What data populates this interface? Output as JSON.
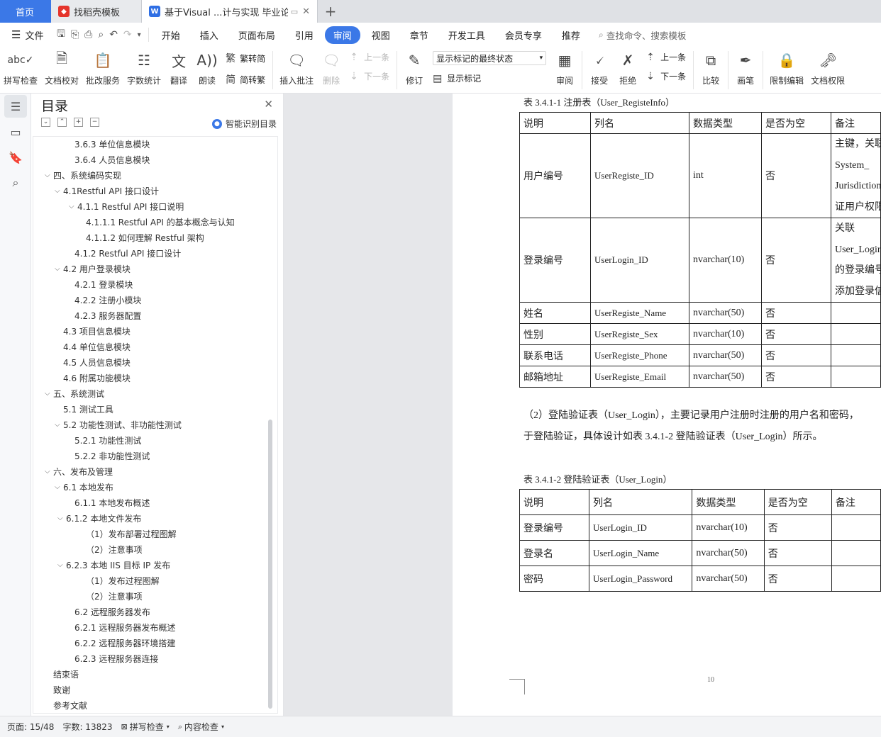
{
  "tabs": {
    "home": "首页",
    "template": "找稻壳模板",
    "doc": "基于Visual ...计与实现 毕业论文"
  },
  "menu": {
    "file": "文件",
    "items": [
      "开始",
      "插入",
      "页面布局",
      "引用",
      "审阅",
      "视图",
      "章节",
      "开发工具",
      "会员专享",
      "推荐"
    ],
    "active": "审阅",
    "search": "查找命令、搜索模板"
  },
  "ribbon": {
    "spell": "拼写检查",
    "proof": "文档校对",
    "batch": "批改服务",
    "count": "字数统计",
    "translate": "翻译",
    "read": "朗读",
    "to_trad": "繁转简",
    "to_simp": "简转繁",
    "insert_comment": "插入批注",
    "delete": "删除",
    "prev": "上一条",
    "next": "下一条",
    "revise": "修订",
    "markup_state": "显示标记的最终状态",
    "show_markup": "显示标记",
    "review": "审阅",
    "accept": "接受",
    "reject": "拒绝",
    "prev2": "上一条",
    "next2": "下一条",
    "compare": "比较",
    "pen": "画笔",
    "restrict": "限制编辑",
    "perm": "文档权限"
  },
  "toc": {
    "title": "目录",
    "smart": "智能识别目录",
    "items": [
      {
        "text": "3.6.3  单位信息模块",
        "level": 3,
        "caret": false
      },
      {
        "text": "3.6.4  人员信息模块",
        "level": 3,
        "caret": false
      },
      {
        "text": "四、系统编码实现",
        "level": 1,
        "caret": true
      },
      {
        "text": "4.1Restful API 接口设计",
        "level": 2,
        "caret": true
      },
      {
        "text": "4.1.1 Restful API 接口说明",
        "level": 3,
        "caret": true
      },
      {
        "text": "4.1.1.1 Restful API 的基本概念与认知",
        "level": 4,
        "caret": false
      },
      {
        "text": "4.1.1.2  如何理解 Restful 架构",
        "level": 4,
        "caret": false
      },
      {
        "text": "4.1.2 Restful API 接口设计",
        "level": 3,
        "caret": false
      },
      {
        "text": "4.2 用户登录模块",
        "level": 2,
        "caret": true
      },
      {
        "text": "4.2.1 登录模块",
        "level": 3,
        "caret": false
      },
      {
        "text": "4.2.2 注册小模块",
        "level": 3,
        "caret": false
      },
      {
        "text": "4.2.3 服务器配置",
        "level": 3,
        "caret": false
      },
      {
        "text": "4.3 项目信息模块",
        "level": 2,
        "caret": false
      },
      {
        "text": "4.4 单位信息模块",
        "level": 2,
        "caret": false
      },
      {
        "text": "4.5 人员信息模块",
        "level": 2,
        "caret": false
      },
      {
        "text": "4.6 附属功能模块",
        "level": 2,
        "caret": false
      },
      {
        "text": "五、系统测试",
        "level": 1,
        "caret": true
      },
      {
        "text": "5.1 测试工具",
        "level": 2,
        "caret": false
      },
      {
        "text": "5.2 功能性测试、非功能性测试",
        "level": 2,
        "caret": true
      },
      {
        "text": "5.2.1  功能性测试",
        "level": 3,
        "caret": false
      },
      {
        "text": "5.2.2  非功能性测试",
        "level": 3,
        "caret": false
      },
      {
        "text": "六、发布及管理",
        "level": 1,
        "caret": true
      },
      {
        "text": "6.1 本地发布",
        "level": 2,
        "caret": true
      },
      {
        "text": "6.1.1  本地发布概述",
        "level": 3,
        "caret": false
      },
      {
        "text": "6.1.2  本地文件发布",
        "level": 2.5,
        "caret": true
      },
      {
        "text": "（1）发布部署过程图解",
        "level": 4,
        "caret": false
      },
      {
        "text": "（2）注意事项",
        "level": 4,
        "caret": false
      },
      {
        "text": "6.2.3  本地 IIS 目标 IP 发布",
        "level": 2.5,
        "caret": true
      },
      {
        "text": "（1）发布过程图解",
        "level": 4,
        "caret": false
      },
      {
        "text": "（2）注意事项",
        "level": 4,
        "caret": false
      },
      {
        "text": "6.2  远程服务器发布",
        "level": 3,
        "caret": false
      },
      {
        "text": "6.2.1 远程服务器发布概述",
        "level": 3,
        "caret": false
      },
      {
        "text": "6.2.2 远程服务器环境搭建",
        "level": 3,
        "caret": false
      },
      {
        "text": "6.2.3 远程服务器连接",
        "level": 3,
        "caret": false
      },
      {
        "text": "结束语",
        "level": 1,
        "caret": false
      },
      {
        "text": "致谢",
        "level": 1,
        "caret": false
      },
      {
        "text": "参考文献",
        "level": 1,
        "caret": false
      }
    ]
  },
  "doc": {
    "caption1": "表 3.4.1-1   注册表（User_RegisteInfo）",
    "table1": {
      "headers": [
        "说明",
        "列名",
        "数据类型",
        "是否为空",
        "备注"
      ],
      "rows": [
        {
          "c": [
            "用户编号",
            "UserRegiste_ID",
            "int",
            "否"
          ],
          "note": [
            "主键，关联",
            "System_",
            "Jurisdiction",
            "证用户权限"
          ]
        },
        {
          "c": [
            "登录编号",
            "UserLogin_ID",
            "nvarchar(10)",
            "否"
          ],
          "note": [
            "关联",
            "User_Login",
            "的登录编号",
            "添加登录信"
          ]
        },
        {
          "c": [
            "姓名",
            "UserRegiste_Name",
            "nvarchar(50)",
            "否"
          ],
          "note": []
        },
        {
          "c": [
            "性别",
            "UserRegiste_Sex",
            "nvarchar(10)",
            "否"
          ],
          "note": []
        },
        {
          "c": [
            "联系电话",
            "UserRegiste_Phone",
            "nvarchar(50)",
            "否"
          ],
          "note": []
        },
        {
          "c": [
            "邮箱地址",
            "UserRegiste_Email",
            "nvarchar(50)",
            "否"
          ],
          "note": []
        }
      ]
    },
    "para_line1": "（2）登陆验证表（User_Login），主要记录用户注册时注册的用户名和密码，",
    "para_line2": "于登陆验证，具体设计如表 3.4.1-2  登陆验证表（User_Login）所示。",
    "caption2": "表 3.4.1-2  登陆验证表（User_Login）",
    "table2": {
      "headers": [
        "说明",
        "列名",
        "数据类型",
        "是否为空",
        "备注"
      ],
      "rows": [
        [
          "登录编号",
          "UserLogin_ID",
          "nvarchar(10)",
          "否",
          ""
        ],
        [
          "登录名",
          "UserLogin_Name",
          "nvarchar(50)",
          "否",
          ""
        ],
        [
          "密码",
          "UserLogin_Password",
          "nvarchar(50)",
          "否",
          ""
        ]
      ]
    },
    "page_number": "10"
  },
  "status": {
    "page": "页面: 15/48",
    "words": "字数: 13823",
    "spell": "拼写检查",
    "content": "内容检查"
  }
}
